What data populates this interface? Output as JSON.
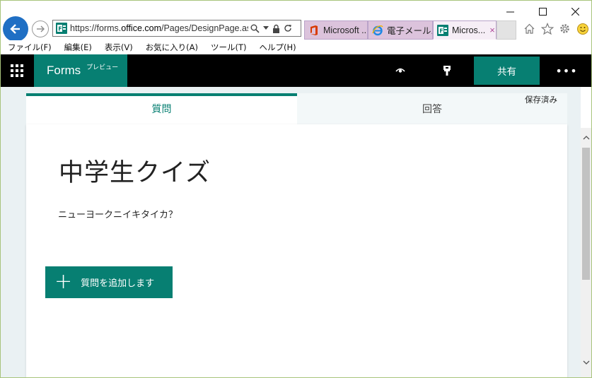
{
  "browser": {
    "url_prefix": "https://forms.",
    "url_domain": "office.com",
    "url_path": "/Pages/DesignPage.aspx",
    "tabs": [
      {
        "label": "Microsoft ...",
        "icon": "office-icon"
      },
      {
        "label": "電子メール...",
        "icon": "ie-icon"
      },
      {
        "label": "Micros...",
        "icon": "forms-icon",
        "close": "×"
      }
    ],
    "menu": [
      "ファイル(F)",
      "編集(E)",
      "表示(V)",
      "お気に入り(A)",
      "ツール(T)",
      "ヘルプ(H)"
    ]
  },
  "app": {
    "brand": "Forms",
    "preview_label": "プレビュー",
    "share_label": "共有",
    "more_label": "•••",
    "accent": "#077f72"
  },
  "form": {
    "saved_status": "保存済み",
    "tabs": [
      {
        "label": "質問",
        "active": true
      },
      {
        "label": "回答",
        "active": false
      }
    ],
    "title": "中学生クイズ",
    "description": "ニューヨークニイキタイカ？",
    "add_question_label": "質問を追加します",
    "add_question_icon": "+"
  }
}
